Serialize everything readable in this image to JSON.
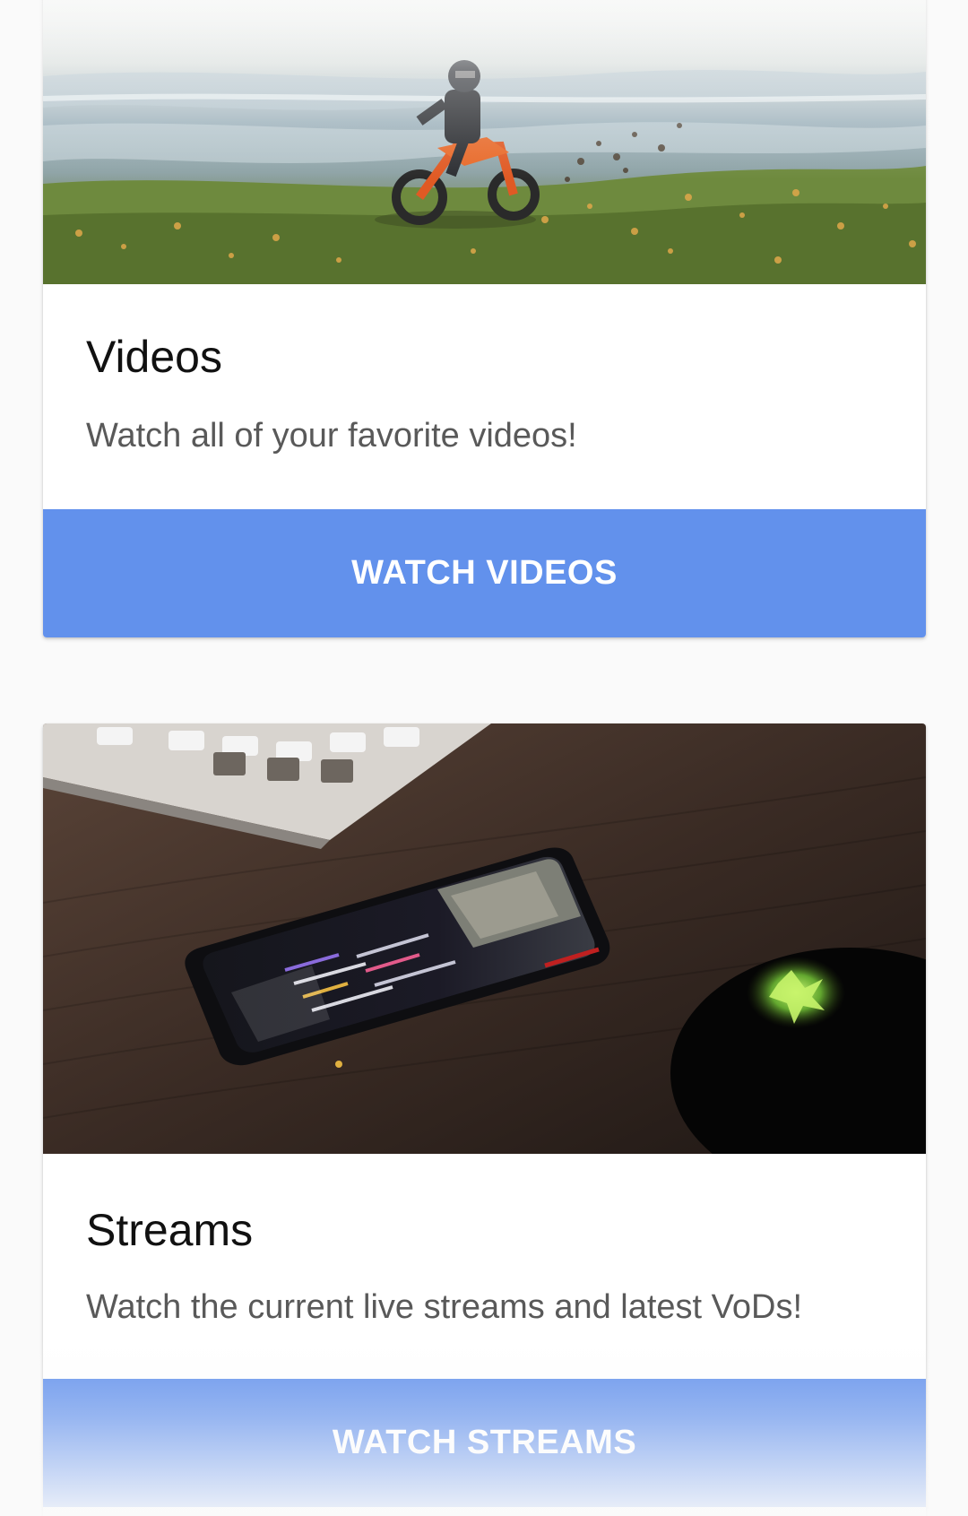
{
  "cards": [
    {
      "image": "dirt-bike-rider-in-flower-field",
      "title": "Videos",
      "description": "Watch all of your favorite videos!",
      "action_label": "WATCH VIDEOS"
    },
    {
      "image": "smartphone-on-desk-with-keyboard-and-mouse",
      "title": "Streams",
      "description": "Watch the current live streams and latest VoDs!",
      "action_label": "WATCH STREAMS"
    }
  ],
  "colors": {
    "background": "#fafafa",
    "card": "#ffffff",
    "accent": "#6291ec",
    "title_text": "#111111",
    "body_text": "#595959"
  }
}
